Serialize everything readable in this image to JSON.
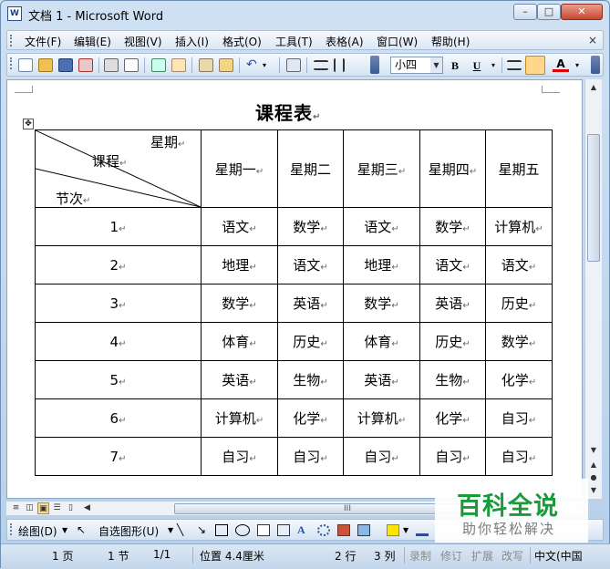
{
  "window": {
    "title": "文档 1 - Microsoft Word",
    "app_icon": "W",
    "minimize": "–",
    "maximize": "□",
    "close": "✕"
  },
  "menubar": {
    "items": [
      "文件(F)",
      "编辑(E)",
      "视图(V)",
      "插入(I)",
      "格式(O)",
      "工具(T)",
      "表格(A)",
      "窗口(W)",
      "帮助(H)"
    ],
    "close_doc": "×"
  },
  "toolbar": {
    "font_size": "小四",
    "bold": "B",
    "underline": "U",
    "font_color_label": "A",
    "icons": [
      "new-document-icon",
      "open-folder-icon",
      "save-icon",
      "permission-icon",
      "print-icon",
      "print-preview-icon",
      "spelling-icon",
      "research-icon",
      "paste-icon",
      "format-painter-icon",
      "undo-icon",
      "table-icon",
      "columns-icon"
    ]
  },
  "document": {
    "title": "课程表",
    "return_mark": "↵",
    "header_diagonal": {
      "top": "星期",
      "middle": "课程",
      "bottom": "节次"
    },
    "days": [
      "星期一",
      "星期二",
      "星期三",
      "星期四",
      "星期五"
    ],
    "rows": [
      {
        "period": "1",
        "classes": [
          "语文",
          "数学",
          "语文",
          "数学",
          "计算机"
        ]
      },
      {
        "period": "2",
        "classes": [
          "地理",
          "语文",
          "地理",
          "语文",
          "语文"
        ]
      },
      {
        "period": "3",
        "classes": [
          "数学",
          "英语",
          "数学",
          "英语",
          "历史"
        ]
      },
      {
        "period": "4",
        "classes": [
          "体育",
          "历史",
          "体育",
          "历史",
          "数学"
        ]
      },
      {
        "period": "5",
        "classes": [
          "英语",
          "生物",
          "英语",
          "生物",
          "化学"
        ]
      },
      {
        "period": "6",
        "classes": [
          "计算机",
          "化学",
          "计算机",
          "化学",
          "自习"
        ]
      },
      {
        "period": "7",
        "classes": [
          "自习",
          "自习",
          "自习",
          "自习",
          "自习"
        ]
      }
    ]
  },
  "hscroll": {
    "thumb_label": "III"
  },
  "drawbar": {
    "draw_label": "绘图(D)",
    "autoshapes_label": "自选图形(U)"
  },
  "statusbar": {
    "page": "1 页",
    "section": "1 节",
    "page_of": "1/1",
    "position": "位置 4.4厘米",
    "line": "2 行",
    "column": "3 列",
    "rec": "录制",
    "trk": "修订",
    "ext": "扩展",
    "ovr": "改写",
    "language": "中文(中国"
  },
  "watermark": {
    "main": "百科全说",
    "sub": "助你轻松解决"
  }
}
